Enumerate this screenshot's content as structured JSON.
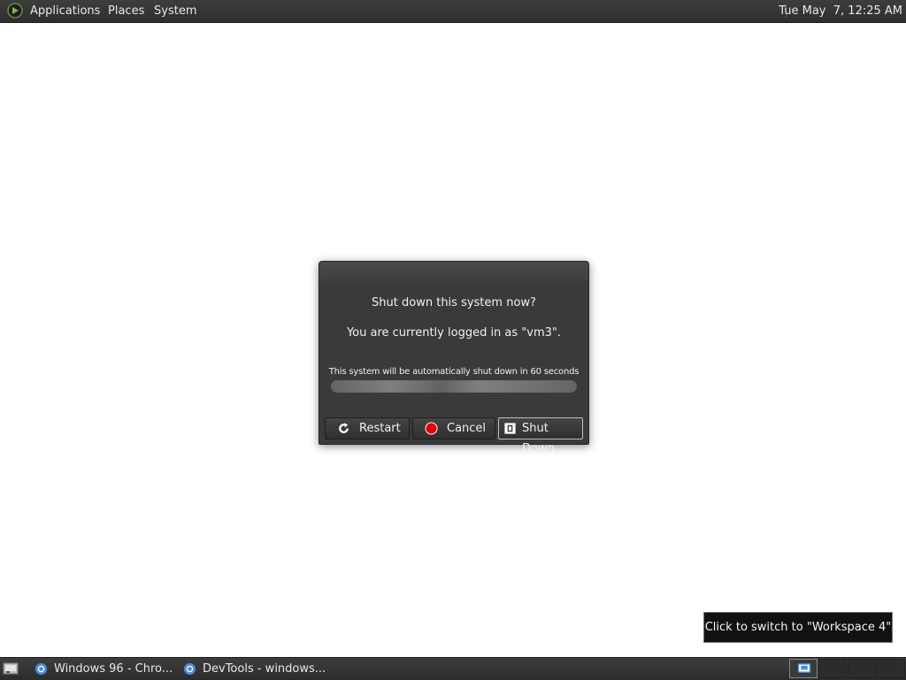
{
  "top_panel": {
    "menus": [
      "Applications",
      "Places",
      "System"
    ],
    "clock": "Tue May  7, 12:25 AM"
  },
  "dialog": {
    "title": "Shut down this system now?",
    "subtitle": "You are currently logged in as \"vm3\".",
    "countdown": "This system will be automatically shut down in 60 seconds",
    "progress": 1.0,
    "buttons": {
      "restart": "Restart",
      "cancel": "Cancel",
      "shutdown": "Shut Down"
    }
  },
  "tooltip": {
    "text": "Click to switch to \"Workspace 4\""
  },
  "taskbar": {
    "tasks": [
      {
        "label": "Windows 96 - Chro...",
        "icon": "chrome-icon"
      },
      {
        "label": "DevTools - windows...",
        "icon": "chrome-icon"
      }
    ],
    "workspaces_active": 1
  },
  "colors": {
    "panel": "#333333",
    "dialog": "#3a3a3a",
    "cancel_red": "#e00000"
  }
}
